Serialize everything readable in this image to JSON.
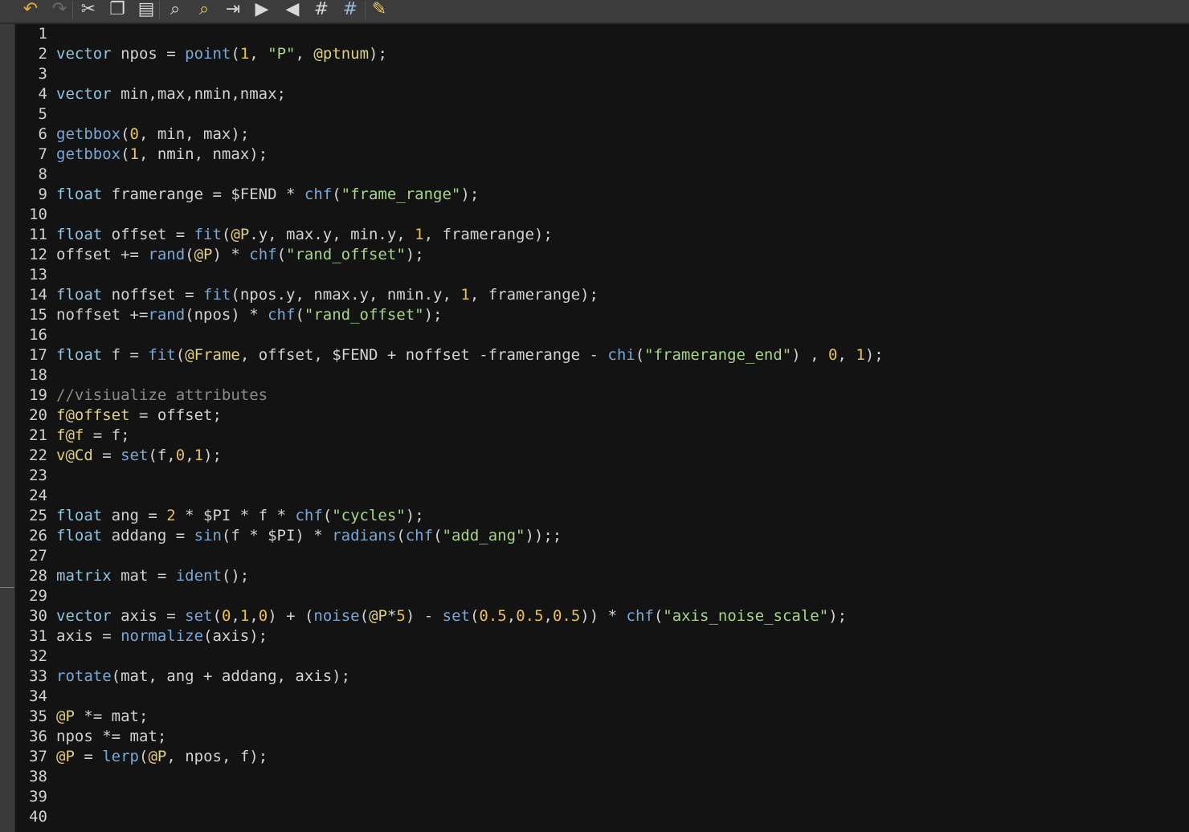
{
  "toolbar": {
    "tools": [
      {
        "name": "undo-icon",
        "symbol": "↶",
        "color": "#e9a93a"
      },
      {
        "name": "redo-icon",
        "symbol": "↷",
        "color": "#6b6b6b"
      },
      {
        "name": "cut-icon",
        "symbol": "✂",
        "color": "#d7d7d7"
      },
      {
        "name": "copy-icon",
        "symbol": "❐",
        "color": "#d7d7d7"
      },
      {
        "name": "paste-icon",
        "symbol": "▤",
        "color": "#d7d7d7"
      },
      {
        "name": "find-icon",
        "symbol": "⌕",
        "color": "#d7d7d7"
      },
      {
        "name": "find-replace-icon",
        "symbol": "⌕",
        "color": "#e0c070"
      },
      {
        "name": "goto-line-icon",
        "symbol": "⇥",
        "color": "#d7d7d7"
      },
      {
        "name": "indent-icon",
        "symbol": "▶",
        "color": "#d7d7d7"
      },
      {
        "name": "unindent-icon",
        "symbol": "◀",
        "color": "#d7d7d7"
      },
      {
        "name": "comment-icon",
        "symbol": "#",
        "color": "#d7d7d7"
      },
      {
        "name": "uncomment-icon",
        "symbol": "#",
        "color": "#9bbbe0"
      },
      {
        "name": "edit-notes-icon",
        "symbol": "✎",
        "color": "#e8c15a"
      }
    ]
  },
  "colors": {
    "background": "#131313",
    "text": "#d2d2d2",
    "keyword_type": "#8fc3e0",
    "function": "#79a8d6",
    "number": "#e8c15a",
    "string": "#a9d58a",
    "attribute": "#e0cf80",
    "comment": "#8a8a8a"
  },
  "editor": {
    "lines": [
      [],
      [
        [
          "type",
          "vector"
        ],
        [
          "id",
          " npos = "
        ],
        [
          "fn",
          "point"
        ],
        [
          "op",
          "("
        ],
        [
          "num",
          "1"
        ],
        [
          "op",
          ", "
        ],
        [
          "str",
          "\"P\""
        ],
        [
          "op",
          ", "
        ],
        [
          "attr",
          "@ptnum"
        ],
        [
          "op",
          ");"
        ]
      ],
      [],
      [
        [
          "type",
          "vector"
        ],
        [
          "id",
          " min,max,nmin,nmax;"
        ]
      ],
      [],
      [
        [
          "fn",
          "getbbox"
        ],
        [
          "op",
          "("
        ],
        [
          "num",
          "0"
        ],
        [
          "id",
          ", min, max);"
        ]
      ],
      [
        [
          "fn",
          "getbbox"
        ],
        [
          "op",
          "("
        ],
        [
          "num",
          "1"
        ],
        [
          "id",
          ", nmin, nmax);"
        ]
      ],
      [],
      [
        [
          "type",
          "float"
        ],
        [
          "id",
          " framerange = $FEND * "
        ],
        [
          "fn",
          "chf"
        ],
        [
          "op",
          "("
        ],
        [
          "str",
          "\"frame_range\""
        ],
        [
          "op",
          ");"
        ]
      ],
      [],
      [
        [
          "type",
          "float"
        ],
        [
          "id",
          " offset = "
        ],
        [
          "fn",
          "fit"
        ],
        [
          "op",
          "("
        ],
        [
          "attr",
          "@P"
        ],
        [
          "id",
          ".y, max.y, min.y, "
        ],
        [
          "num",
          "1"
        ],
        [
          "id",
          ", framerange);"
        ]
      ],
      [
        [
          "id",
          "offset += "
        ],
        [
          "fn",
          "rand"
        ],
        [
          "op",
          "("
        ],
        [
          "attr",
          "@P"
        ],
        [
          "op",
          ") * "
        ],
        [
          "fn",
          "chf"
        ],
        [
          "op",
          "("
        ],
        [
          "str",
          "\"rand_offset\""
        ],
        [
          "op",
          ");"
        ]
      ],
      [],
      [
        [
          "type",
          "float"
        ],
        [
          "id",
          " noffset = "
        ],
        [
          "fn",
          "fit"
        ],
        [
          "id",
          "(npos.y, nmax.y, nmin.y, "
        ],
        [
          "num",
          "1"
        ],
        [
          "id",
          ", framerange);"
        ]
      ],
      [
        [
          "id",
          "noffset +="
        ],
        [
          "fn",
          "rand"
        ],
        [
          "id",
          "(npos) * "
        ],
        [
          "fn",
          "chf"
        ],
        [
          "op",
          "("
        ],
        [
          "str",
          "\"rand_offset\""
        ],
        [
          "op",
          ");"
        ]
      ],
      [],
      [
        [
          "type",
          "float"
        ],
        [
          "id",
          " f = "
        ],
        [
          "fn",
          "fit"
        ],
        [
          "op",
          "("
        ],
        [
          "attr",
          "@Frame"
        ],
        [
          "id",
          ", offset, $FEND + noffset -framerange - "
        ],
        [
          "fn",
          "chi"
        ],
        [
          "op",
          "("
        ],
        [
          "str",
          "\"framerange_end\""
        ],
        [
          "op",
          ") , "
        ],
        [
          "num",
          "0"
        ],
        [
          "op",
          ", "
        ],
        [
          "num",
          "1"
        ],
        [
          "op",
          ");"
        ]
      ],
      [],
      [
        [
          "com",
          "//visiualize attributes"
        ]
      ],
      [
        [
          "attr",
          "f@offset"
        ],
        [
          "id",
          " = offset;"
        ]
      ],
      [
        [
          "attr",
          "f@f"
        ],
        [
          "id",
          " = f;"
        ]
      ],
      [
        [
          "attr",
          "v@Cd"
        ],
        [
          "id",
          " = "
        ],
        [
          "fn",
          "set"
        ],
        [
          "id",
          "(f,"
        ],
        [
          "num",
          "0"
        ],
        [
          "op",
          ","
        ],
        [
          "num",
          "1"
        ],
        [
          "op",
          ");"
        ]
      ],
      [],
      [],
      [
        [
          "type",
          "float"
        ],
        [
          "id",
          " ang = "
        ],
        [
          "num",
          "2"
        ],
        [
          "id",
          " * $PI * f * "
        ],
        [
          "fn",
          "chf"
        ],
        [
          "op",
          "("
        ],
        [
          "str",
          "\"cycles\""
        ],
        [
          "op",
          ");"
        ]
      ],
      [
        [
          "type",
          "float"
        ],
        [
          "id",
          " addang = "
        ],
        [
          "fn",
          "sin"
        ],
        [
          "id",
          "(f * $PI) * "
        ],
        [
          "fn",
          "radians"
        ],
        [
          "op",
          "("
        ],
        [
          "fn",
          "chf"
        ],
        [
          "op",
          "("
        ],
        [
          "str",
          "\"add_ang\""
        ],
        [
          "op",
          "));;"
        ]
      ],
      [],
      [
        [
          "type",
          "matrix"
        ],
        [
          "id",
          " mat = "
        ],
        [
          "fn",
          "ident"
        ],
        [
          "op",
          "();"
        ]
      ],
      [],
      [
        [
          "type",
          "vector"
        ],
        [
          "id",
          " axis = "
        ],
        [
          "fn",
          "set"
        ],
        [
          "op",
          "("
        ],
        [
          "num",
          "0"
        ],
        [
          "op",
          ","
        ],
        [
          "num",
          "1"
        ],
        [
          "op",
          ","
        ],
        [
          "num",
          "0"
        ],
        [
          "op",
          ") + ("
        ],
        [
          "fn",
          "noise"
        ],
        [
          "op",
          "("
        ],
        [
          "attr",
          "@P"
        ],
        [
          "op",
          "*"
        ],
        [
          "num",
          "5"
        ],
        [
          "op",
          ") - "
        ],
        [
          "fn",
          "set"
        ],
        [
          "op",
          "("
        ],
        [
          "num",
          "0.5"
        ],
        [
          "op",
          ","
        ],
        [
          "num",
          "0.5"
        ],
        [
          "op",
          ","
        ],
        [
          "num",
          "0.5"
        ],
        [
          "op",
          ")) * "
        ],
        [
          "fn",
          "chf"
        ],
        [
          "op",
          "("
        ],
        [
          "str",
          "\"axis_noise_scale\""
        ],
        [
          "op",
          ");"
        ]
      ],
      [
        [
          "id",
          "axis = "
        ],
        [
          "fn",
          "normalize"
        ],
        [
          "id",
          "(axis);"
        ]
      ],
      [],
      [
        [
          "fn",
          "rotate"
        ],
        [
          "id",
          "(mat, ang + addang, axis);"
        ]
      ],
      [],
      [
        [
          "attr",
          "@P"
        ],
        [
          "id",
          " *= mat;"
        ]
      ],
      [
        [
          "id",
          "npos *= mat;"
        ]
      ],
      [
        [
          "attr",
          "@P"
        ],
        [
          "id",
          " = "
        ],
        [
          "fn",
          "lerp"
        ],
        [
          "op",
          "("
        ],
        [
          "attr",
          "@P"
        ],
        [
          "id",
          ", npos, f);"
        ]
      ],
      [],
      [],
      []
    ]
  }
}
